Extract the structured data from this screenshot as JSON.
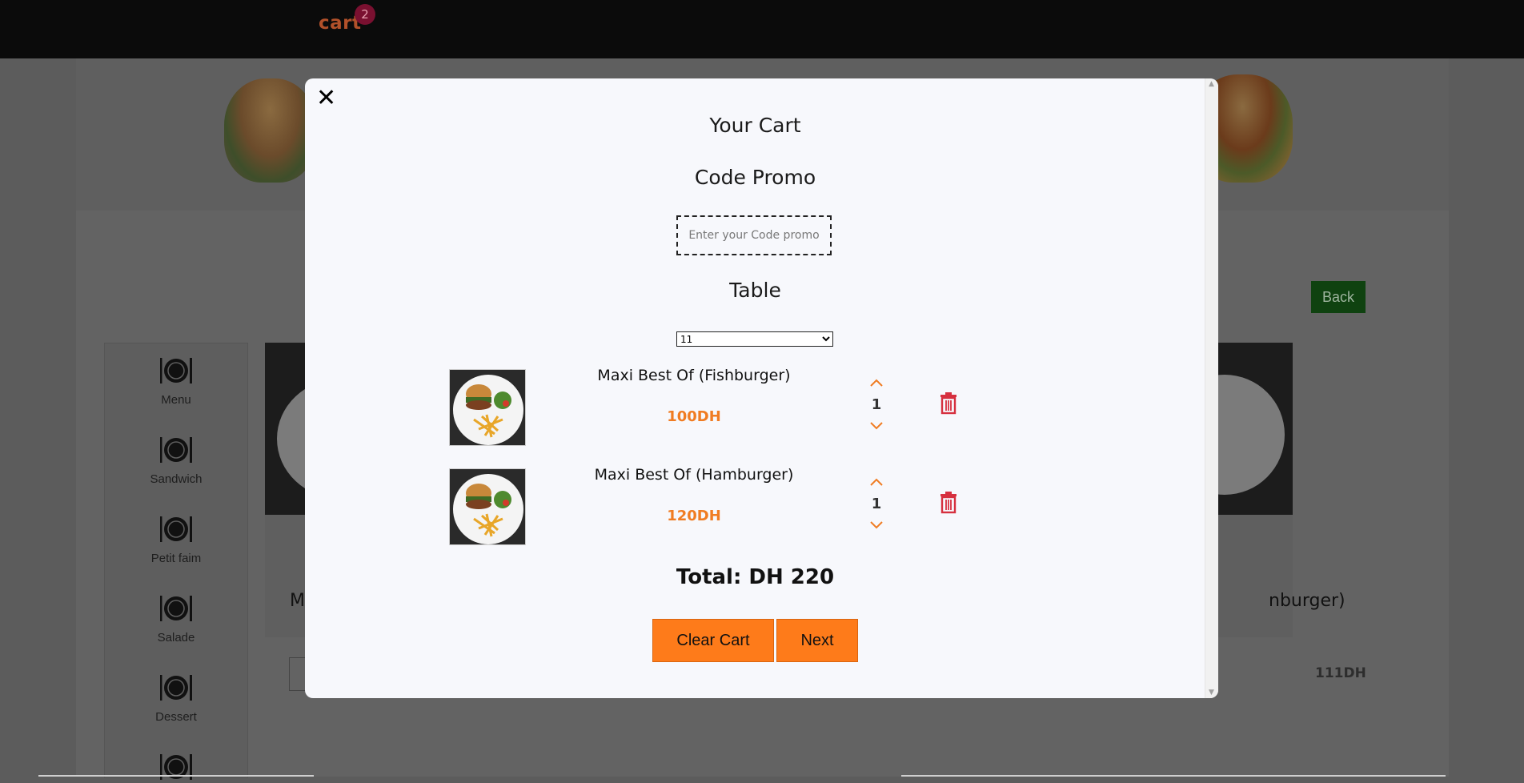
{
  "header": {
    "cart_label": "cart",
    "cart_count": "2"
  },
  "background": {
    "back_button": "Back",
    "sidebar": {
      "items": [
        {
          "label": "Menu",
          "icon": "plate-cutlery-icon"
        },
        {
          "label": "Sandwich",
          "icon": "plate-cutlery-icon"
        },
        {
          "label": "Petit faim",
          "icon": "plate-cutlery-icon"
        },
        {
          "label": "Salade",
          "icon": "plate-cutlery-icon"
        },
        {
          "label": "Dessert",
          "icon": "plate-cutlery-icon"
        },
        {
          "label": "",
          "icon": "plate-cutlery-icon"
        }
      ]
    },
    "card_left_title_fragment": "M",
    "card_right_title_fragment": "nburger)",
    "card_right_price": "111DH"
  },
  "modal": {
    "close_icon": "close-icon",
    "title": "Your Cart",
    "promo_heading": "Code Promo",
    "promo_placeholder": "Enter your Code promo",
    "promo_value": "",
    "table_heading": "Table",
    "table_selected": "11",
    "items": [
      {
        "name": "Maxi Best Of (Fishburger)",
        "price": "100DH",
        "quantity": "1"
      },
      {
        "name": "Maxi Best Of (Hamburger)",
        "price": "120DH",
        "quantity": "1"
      }
    ],
    "total": "Total: DH 220",
    "clear_button": "Clear Cart",
    "next_button": "Next"
  },
  "colors": {
    "accent": "#fe7b1a",
    "price": "#f07c22",
    "trash": "#d6303f",
    "back_button": "#0f4210"
  }
}
